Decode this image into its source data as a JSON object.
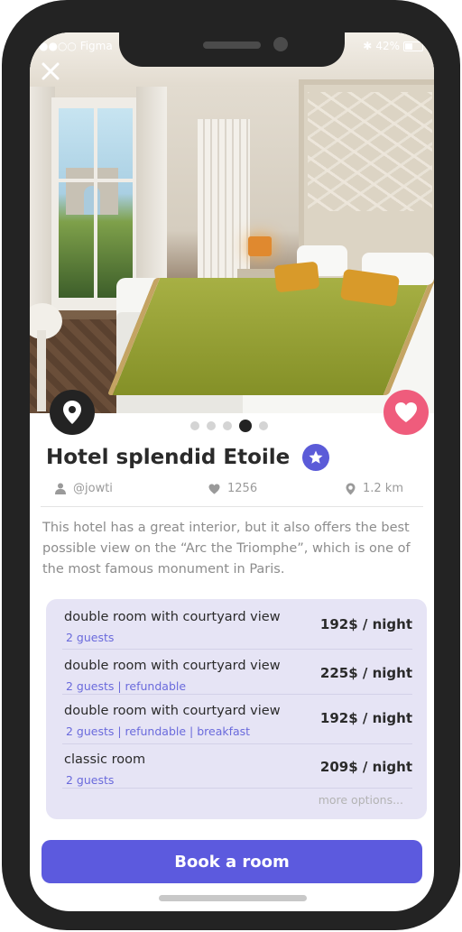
{
  "status_bar": {
    "carrier": "●●○○ Figma",
    "bluetooth": "✱",
    "battery": "42%"
  },
  "header": {
    "close_icon": "close-icon"
  },
  "hero": {
    "image": "hotel-room-photo",
    "gallery_dots": 5,
    "active_dot": 4
  },
  "actions": {
    "location_icon": "map-pin-icon",
    "favorite_icon": "heart-icon",
    "accent": "#ef5c7c"
  },
  "hotel": {
    "name": "Hotel splendid Etoile",
    "badge_icon": "star-icon",
    "author": "@jowti",
    "likes": "1256",
    "distance": "1.2 km",
    "description": "This hotel has a great interior, but it also offers the best possible view on the “Arc the Triomphe”, which is one of the most famous monument in Paris."
  },
  "rooms": [
    {
      "name": "double room with courtyard view",
      "tags": "2 guests",
      "price": "192$ / night"
    },
    {
      "name": "double room with courtyard view",
      "tags": "2 guests | refundable",
      "price": "225$ / night"
    },
    {
      "name": "double room with courtyard view",
      "tags": "2 guests | refundable | breakfast",
      "price": "192$ / night"
    },
    {
      "name": "classic room",
      "tags": "2 guests",
      "price": "209$ / night"
    }
  ],
  "more_options": "more options...",
  "book_button": {
    "label": "Book a room",
    "color": "#5c5ade"
  }
}
